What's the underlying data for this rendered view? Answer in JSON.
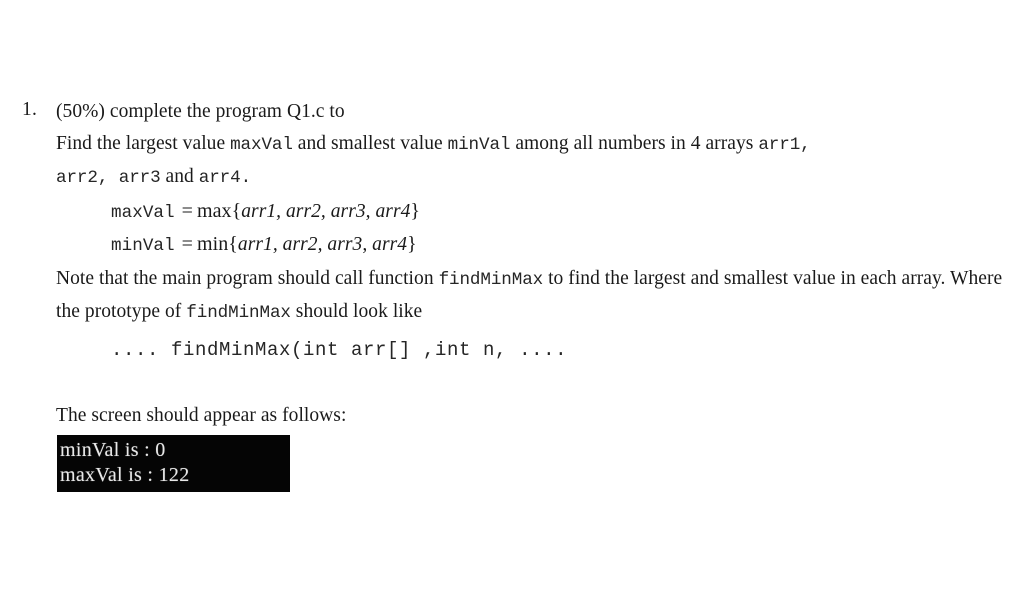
{
  "question": {
    "marker": "1.",
    "intro": "(50%) complete the program Q1.c to",
    "intro_points": "(50%)",
    "intro_rest": "complete the program Q1.c to",
    "line2": {
      "a": "Find the largest value ",
      "code1": "maxVal",
      "b": " and smallest value ",
      "code2": "minVal",
      "c": " among all numbers in 4 arrays ",
      "code3": "arr1,"
    },
    "line3": {
      "code1": "arr2, arr3",
      "a": " and ",
      "code2": "arr4."
    },
    "equations": [
      {
        "lhs": "maxVal",
        "eq": "=",
        "fn": "max",
        "open": "{",
        "args": [
          "arr1",
          "arr2",
          "arr3",
          "arr4"
        ],
        "close": "}"
      },
      {
        "lhs": "minVal",
        "eq": "=",
        "fn": "min",
        "open": "{",
        "args": [
          "arr1",
          "arr2",
          "arr3",
          "arr4"
        ],
        "close": "}"
      }
    ],
    "note": {
      "a": "Note that the main program should call function ",
      "code1": "findMinMax",
      "b": " to find the largest and smallest value in each array. Where the prototype of ",
      "code2": "findMinMax",
      "c": " should look like"
    },
    "prototype": ".... findMinMax(int arr[] ,int n, ....",
    "screen_caption": "The screen should appear as follows:",
    "console": {
      "lines": [
        "minVal is : 0",
        "maxVal is : 122"
      ]
    }
  },
  "colors": {
    "page_background": "#ffffff",
    "body_text": "#1a1a1a",
    "code_text": "#262626",
    "console_background": "#050505",
    "console_text": "#e9e9e9"
  }
}
